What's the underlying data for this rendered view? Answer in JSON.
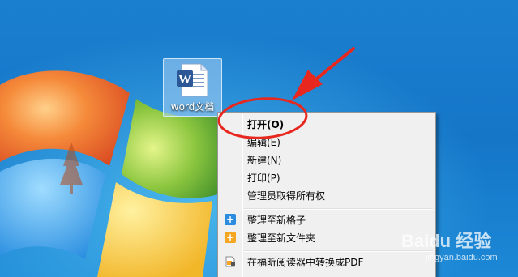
{
  "desktop": {
    "file_icon": {
      "label": "word文档",
      "icon": "word-document-icon"
    }
  },
  "context_menu": {
    "items": [
      {
        "label": "打开(O)",
        "bold": true,
        "icon": null
      },
      {
        "label": "编辑(E)",
        "bold": false,
        "icon": null
      },
      {
        "label": "新建(N)",
        "bold": false,
        "icon": null
      },
      {
        "label": "打印(P)",
        "bold": false,
        "icon": null
      },
      {
        "label": "管理员取得所有权",
        "bold": false,
        "icon": null
      },
      {
        "label": "整理至新格子",
        "bold": false,
        "icon": "blue-plus-icon"
      },
      {
        "label": "整理至新文件夹",
        "bold": false,
        "icon": "orange-plus-icon"
      },
      {
        "label": "在福昕阅读器中转换成PDF",
        "bold": false,
        "icon": "foxit-pdf-icon"
      }
    ]
  },
  "watermark": {
    "brand": "Baidu 经验",
    "url": "jingyan.baidu.com"
  },
  "colors": {
    "desktop_blue": "#1576c8",
    "menu_background": "#f0f0f0",
    "annotation_red": "#e8281e"
  }
}
